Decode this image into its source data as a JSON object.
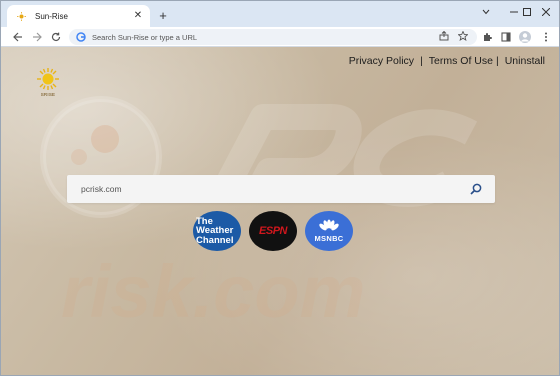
{
  "browser": {
    "tab_title": "Sun-Rise",
    "new_tab": "+",
    "omnibox_placeholder": "Search Sun-Rise or type a URL"
  },
  "page": {
    "logo_label": "SRISE",
    "top_links": [
      "Privacy Policy",
      "Terms Of Use",
      "Uninstall"
    ],
    "separator": "|",
    "search_value": "pcrisk.com",
    "shortcuts": [
      {
        "name": "The Weather Channel",
        "lines": [
          "The",
          "Weather",
          "Channel"
        ]
      },
      {
        "name": "ESPN",
        "label": "ESPN"
      },
      {
        "name": "MSNBC",
        "label": "MSNBC"
      }
    ]
  },
  "colors": {
    "accent": "#1a73e8",
    "weather": "#1c5aa6",
    "espn": "#d0171d",
    "msnbc": "#3b6fd6"
  }
}
